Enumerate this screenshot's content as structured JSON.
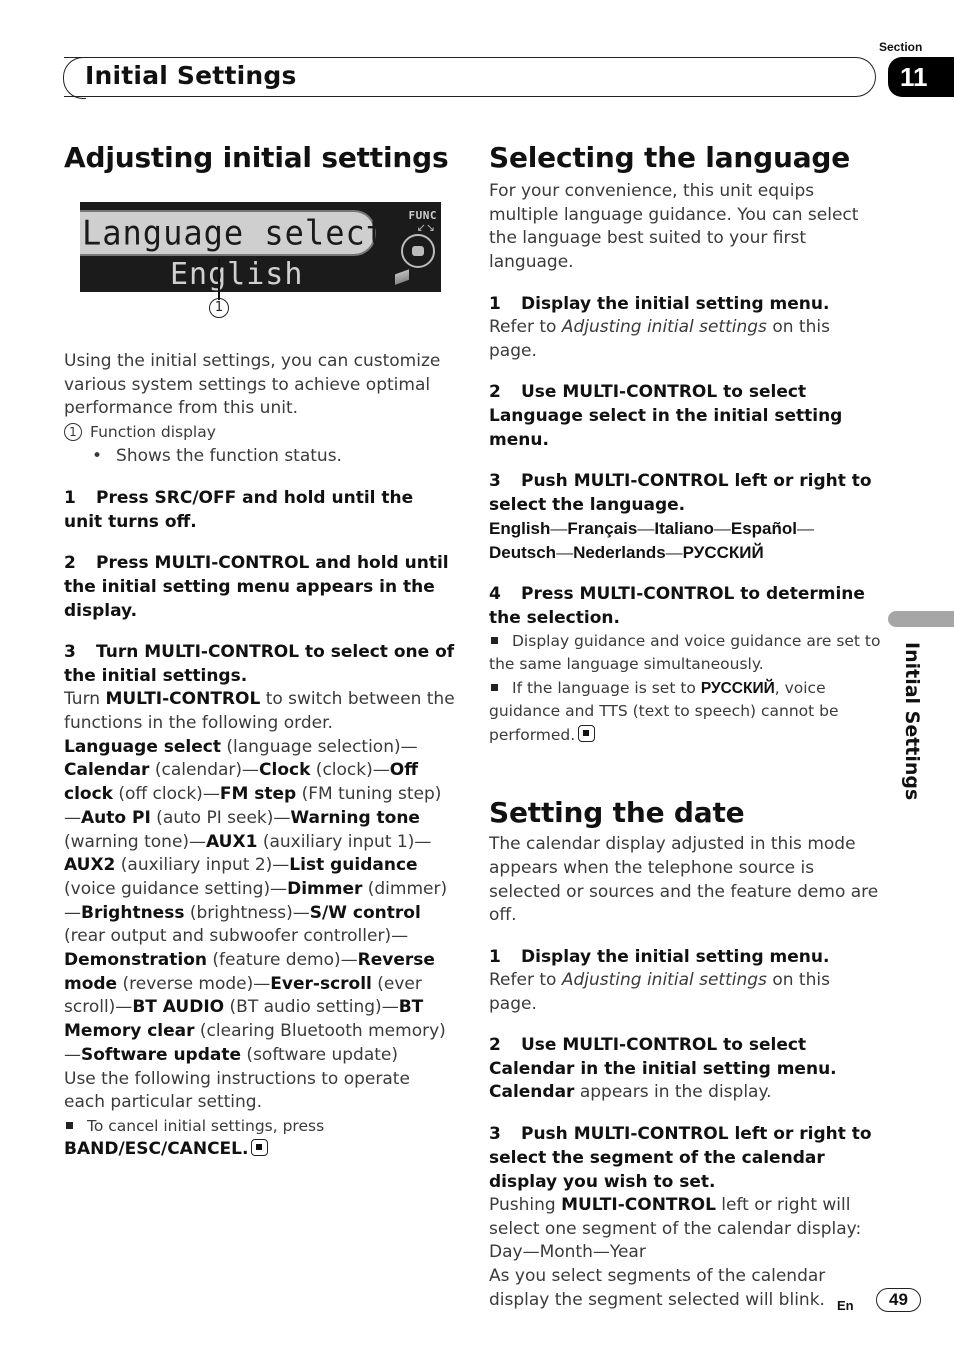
{
  "header": {
    "title": "Initial Settings",
    "section_label": "Section",
    "section_number": "11",
    "side_label": "Initial Settings"
  },
  "left": {
    "title": "Adjusting initial settings",
    "display": {
      "line1": "Language select",
      "line2": "English",
      "func_label": "FUNC",
      "callout": "1"
    },
    "intro": "Using the initial settings, you can customize various system settings to achieve optimal performance from this unit.",
    "callout_item": {
      "num": "1",
      "label": "Function display",
      "bullet": "Shows the function status."
    },
    "step1": {
      "num": "1",
      "text": "Press SRC/OFF and hold until the unit turns off."
    },
    "step2": {
      "num": "2",
      "text": "Press MULTI-CONTROL and hold until the initial setting menu appears in the display."
    },
    "step3": {
      "num": "3",
      "text": "Turn MULTI-CONTROL to select one of the initial settings.",
      "body_pre": "Turn ",
      "body_bold": "MULTI-CONTROL",
      "body_post": " to switch between the functions in the following order."
    },
    "order": [
      {
        "name": "Language select",
        "desc": " (language selection)—"
      },
      {
        "name": "Calendar",
        "desc": " (calendar)—"
      },
      {
        "name": "Clock",
        "desc": " (clock)—"
      },
      {
        "name": "Off clock",
        "desc": " (off clock)—"
      },
      {
        "name": "FM step",
        "desc": " (FM tuning step)—"
      },
      {
        "name": "Auto PI",
        "desc": " (auto PI seek)—"
      },
      {
        "name": "Warning tone",
        "desc": " (warning tone)—"
      },
      {
        "name": "AUX1",
        "desc": " (auxiliary input 1)—"
      },
      {
        "name": "AUX2",
        "desc": " (auxiliary input 2)—"
      },
      {
        "name": "List guidance",
        "desc": " (voice guidance setting)—"
      },
      {
        "name": "Dimmer",
        "desc": " (dimmer)—"
      },
      {
        "name": "Brightness",
        "desc": " (brightness)—"
      },
      {
        "name": "S/W control",
        "desc": " (rear output and subwoofer controller)—"
      },
      {
        "name": "Demonstration",
        "desc": " (feature demo)—"
      },
      {
        "name": "Reverse mode",
        "desc": " (reverse mode)—"
      },
      {
        "name": "Ever-scroll",
        "desc": " (ever scroll)—"
      },
      {
        "name": "BT AUDIO",
        "desc": " (BT audio setting)—"
      },
      {
        "name": "BT Memory clear",
        "desc": " (clearing Bluetooth memory)—"
      },
      {
        "name": "Software update",
        "desc": " (software update)"
      }
    ],
    "outro": "Use the following instructions to operate each particular setting.",
    "note": {
      "text": "To cancel initial settings, press",
      "bold": "BAND/ESC/CANCEL",
      "end": "."
    }
  },
  "right": {
    "lang_title": "Selecting the language",
    "lang_intro": "For your convenience, this unit equips multiple language guidance. You can select the language best suited to your first language.",
    "lang_step1": {
      "num": "1",
      "text": "Display the initial setting menu.",
      "body_pre": "Refer to ",
      "body_italic": "Adjusting initial settings",
      "body_post": " on this page."
    },
    "lang_step2": {
      "num": "2",
      "text": "Use MULTI-CONTROL to select Language select in the initial setting menu."
    },
    "lang_step3": {
      "num": "3",
      "text": "Push MULTI-CONTROL left or right to select the language."
    },
    "languages": [
      "English",
      "Français",
      "Italiano",
      "Español",
      "Deutsch",
      "Nederlands",
      "РУССКИЙ"
    ],
    "lang_step4": {
      "num": "4",
      "text": "Press MULTI-CONTROL to determine the selection."
    },
    "lang_note1": "Display guidance and voice guidance are set to the same language simultaneously.",
    "lang_note2": {
      "pre": "If the language is set to ",
      "bold": "РУССКИЙ",
      "post": ", voice guidance and TTS (text to speech) cannot be performed."
    },
    "date_title": "Setting the date",
    "date_intro": "The calendar display adjusted in this mode appears when the telephone source is selected or sources and the feature demo are off.",
    "date_step1": {
      "num": "1",
      "text": "Display the initial setting menu.",
      "body_pre": "Refer to ",
      "body_italic": "Adjusting initial settings",
      "body_post": " on this page."
    },
    "date_step2": {
      "num": "2",
      "text": "Use MULTI-CONTROL to select Calendar in the initial setting menu.",
      "body_bold": "Calendar",
      "body_post": " appears in the display."
    },
    "date_step3": {
      "num": "3",
      "text": "Push MULTI-CONTROL left or right to select the segment of the calendar display you wish to set.",
      "body_pre": "Pushing ",
      "body_bold": "MULTI-CONTROL",
      "body_post": " left or right will select one segment of the calendar display:",
      "segments": "Day—Month—Year",
      "blink": "As you select segments of the calendar display the segment selected will blink."
    }
  },
  "footer": {
    "lang": "En",
    "page": "49"
  }
}
